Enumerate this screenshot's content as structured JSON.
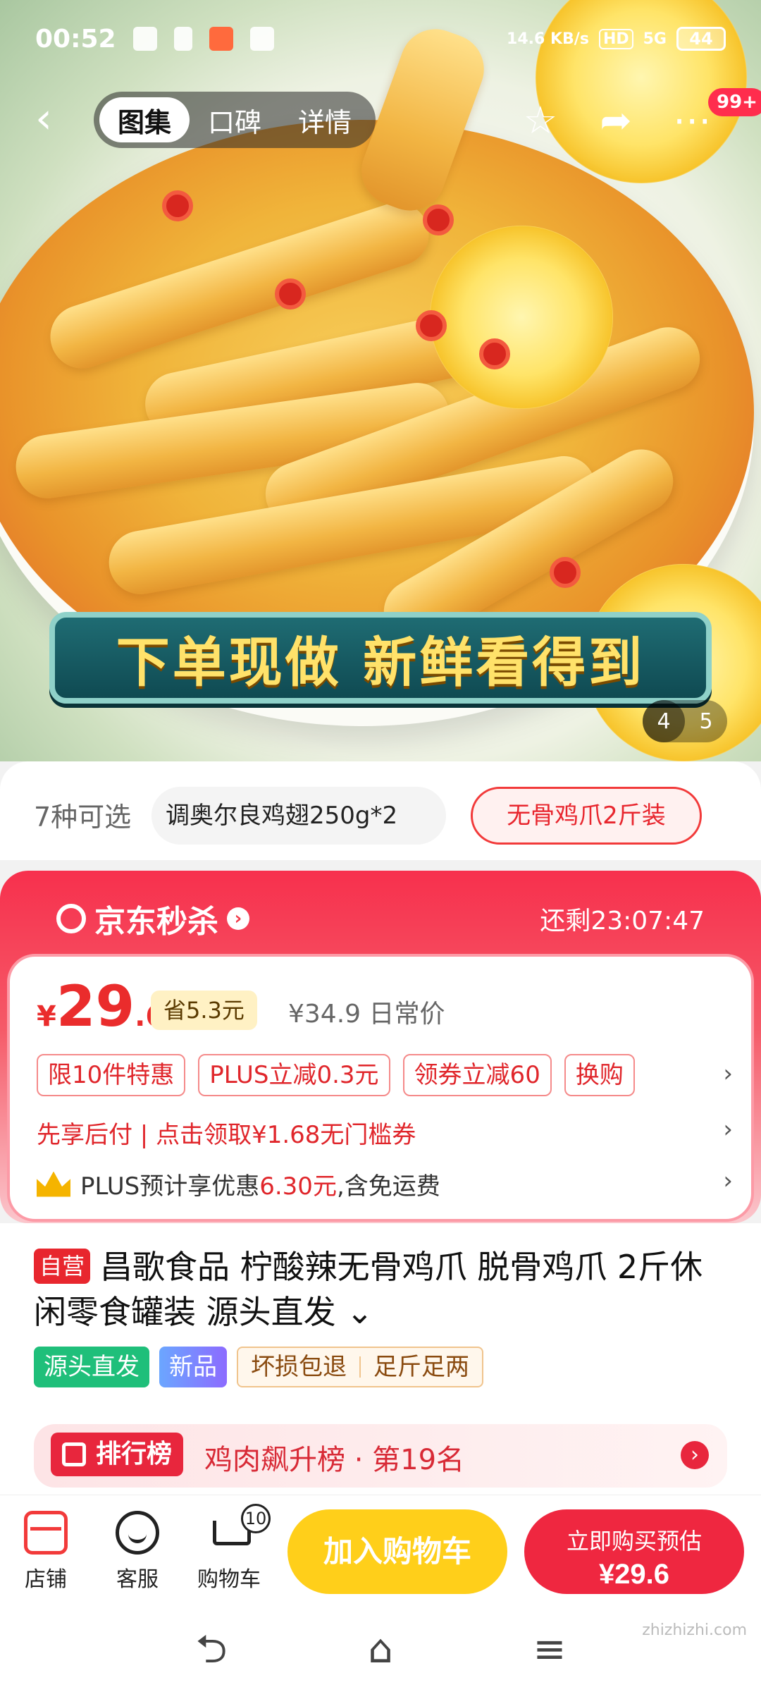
{
  "status_bar": {
    "time": "00:52",
    "net_speed": "14.6 KB/s",
    "hd": "HD",
    "signal": "5G",
    "battery": "44"
  },
  "nav": {
    "tabs": [
      {
        "label": "图集"
      },
      {
        "label": "口碑"
      },
      {
        "label": "详情"
      }
    ],
    "active_tab": 0,
    "notification_badge": "99+"
  },
  "hero": {
    "banner_text": "下单现做 新鲜看得到",
    "pager_current": "4",
    "pager_total": "5"
  },
  "variants": {
    "count_label": "7种可选",
    "option_partial": "调奥尔良鸡翅250g*2",
    "option_selected": "无骨鸡爪2斤装"
  },
  "flash_sale": {
    "title": "京东秒杀",
    "countdown": "还剩23:07:47",
    "currency": "¥",
    "price_int": "29",
    "price_dec": ".6",
    "save_badge": "省5.3元",
    "original_price": "¥34.9 日常价",
    "chips": [
      "限10件特惠",
      "PLUS立减0.3元",
      "领券立减60",
      "换购"
    ],
    "pay_later": "先享后付 | 点击领取¥1.68无门槛券",
    "plus_prefix": "PLUS预计享优惠",
    "plus_amount": "6.30元",
    "plus_suffix": ",含免运费"
  },
  "product": {
    "self_tag": "自营",
    "title": "昌歌食品 柠酸辣无骨鸡爪 脱骨鸡爪 2斤休闲零食罐装 源头直发",
    "tags": [
      "源头直发",
      "新品"
    ],
    "service_tags": [
      "坏损包退",
      "足斤足两"
    ]
  },
  "ranking": {
    "badge": "排行榜",
    "text": "鸡肉飙升榜 · 第19名"
  },
  "bottom_bar": {
    "shop": "店铺",
    "service": "客服",
    "cart": "购物车",
    "cart_count": "10",
    "add_to_cart": "加入购物车",
    "buy_now": "立即购买预估",
    "buy_price": "¥29.6"
  },
  "watermark": "zhizhizhi.com",
  "colors": {
    "accent_red": "#ef2740",
    "cart_yellow": "#ffcf1a",
    "flash_red": "#f7304d"
  }
}
